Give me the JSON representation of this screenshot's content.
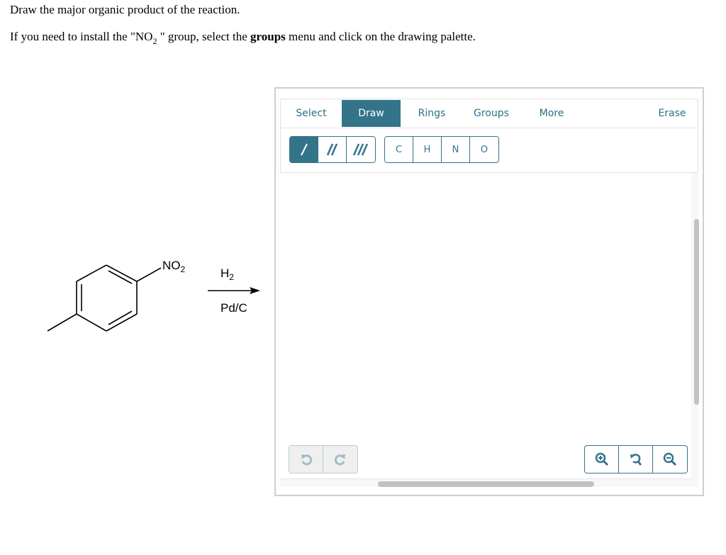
{
  "question": {
    "line1": "Draw the major organic product of the reaction.",
    "line2_before": "If you need to install the \"NO",
    "line2_sub": "2",
    "line2_mid": " \" group, select the ",
    "line2_bold": "groups",
    "line2_after": " menu and click on the drawing palette."
  },
  "reaction": {
    "reactant": "4-nitrotoluene",
    "substituent_label": "NO",
    "substituent_sub": "2",
    "reagent_above": "H",
    "reagent_above_sub": "2",
    "reagent_below": "Pd/C"
  },
  "editor": {
    "tabs": [
      {
        "label": "Select",
        "active": false
      },
      {
        "label": "Draw",
        "active": true
      },
      {
        "label": "Rings",
        "active": false
      },
      {
        "label": "Groups",
        "active": false
      },
      {
        "label": "More",
        "active": false
      },
      {
        "label": "Erase",
        "active": false
      }
    ],
    "bond_tools": [
      {
        "name": "single-bond",
        "active": true
      },
      {
        "name": "double-bond",
        "active": false
      },
      {
        "name": "triple-bond",
        "active": false
      }
    ],
    "atoms": [
      "C",
      "H",
      "N",
      "O"
    ],
    "undo_buttons": [
      "undo",
      "redo"
    ],
    "zoom_buttons": [
      "zoom-in",
      "reset-zoom",
      "zoom-out"
    ],
    "accent_color": "#34748a"
  }
}
